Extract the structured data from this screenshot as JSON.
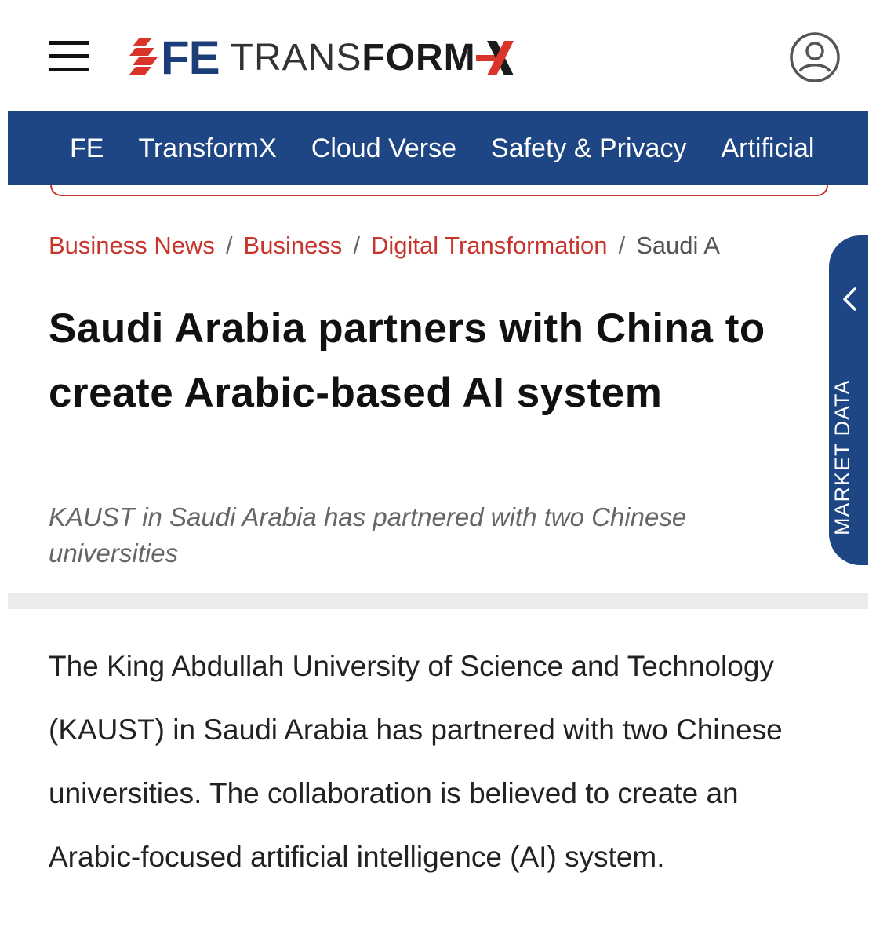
{
  "header": {
    "logo_fe": "FE",
    "logo_trans": "TRANS",
    "logo_form": "FORM",
    "menu_icon": "hamburger-menu-icon",
    "user_icon": "user-profile-icon"
  },
  "nav": {
    "items": [
      "FE",
      "TransformX",
      "Cloud Verse",
      "Safety & Privacy",
      "Artificial"
    ]
  },
  "breadcrumb": {
    "items": [
      "Business News",
      "Business",
      "Digital Transformation"
    ],
    "current": "Saudi A",
    "separator": "/"
  },
  "article": {
    "title": "Saudi Arabia partners with China to create Arabic-based AI system",
    "subtitle": "KAUST in Saudi Arabia has partnered with two Chinese universities",
    "body": "The King Abdullah University of Science and Technology (KAUST) in Saudi Arabia has partnered with two Chinese universities. The collaboration is believed to create an Arabic-focused artificial intelligence (AI) system."
  },
  "market_tab": {
    "label": "MARKET DATA",
    "icon": "chevron-left-icon"
  },
  "colors": {
    "brand_blue": "#1f4684",
    "brand_red": "#c8342b"
  }
}
